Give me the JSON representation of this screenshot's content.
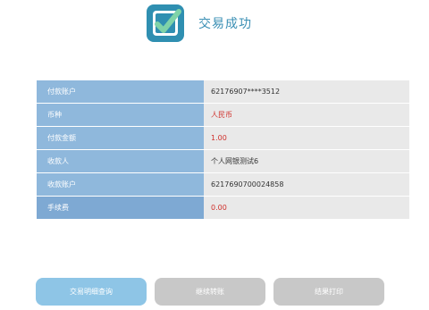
{
  "header": {
    "title": "交易成功",
    "icon": "success-check-icon",
    "icon_color": "#2f8fb1",
    "check_color": "#ffffff"
  },
  "details": [
    {
      "label": "付款账户",
      "value": "62176907****3512",
      "highlight": false
    },
    {
      "label": "币种",
      "value": "人民币",
      "highlight": true
    },
    {
      "label": "付款金额",
      "value": "1.00",
      "highlight": true
    },
    {
      "label": "收款人",
      "value": "个人网银测试6",
      "highlight": false
    },
    {
      "label": "收款账户",
      "value": "6217690700024858",
      "highlight": false
    },
    {
      "label": "手续费",
      "value": "0.00",
      "highlight": true
    }
  ],
  "buttons": {
    "query_label": "交易明细查询",
    "continue_label": "继续转账",
    "print_label": "结果打印"
  },
  "colors": {
    "label_bg": "#8fb8dc",
    "value_bg": "#e9e9e9",
    "highlight_text": "#d0302b",
    "primary_button": "#8ec5e6",
    "secondary_button": "#c8c8c8"
  }
}
